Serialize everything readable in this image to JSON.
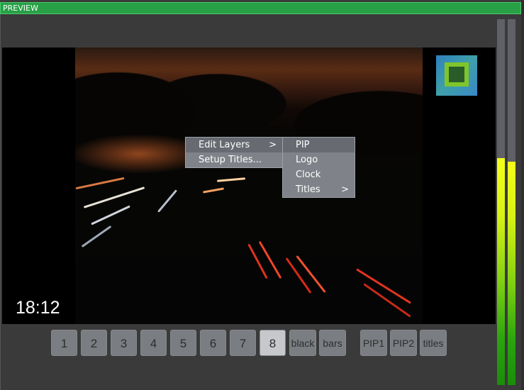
{
  "panel": {
    "title": "PREVIEW"
  },
  "overlay": {
    "clock_text": "18:12"
  },
  "context_menu": {
    "items": [
      {
        "label": "Edit Layers",
        "arrow": ">"
      },
      {
        "label": "Setup Titles..."
      }
    ]
  },
  "submenu": {
    "items": [
      {
        "label": "PIP"
      },
      {
        "label": "Logo"
      },
      {
        "label": "Clock"
      },
      {
        "label": "Titles",
        "arrow": ">"
      }
    ]
  },
  "buttons": [
    {
      "label": "1"
    },
    {
      "label": "2"
    },
    {
      "label": "3"
    },
    {
      "label": "4"
    },
    {
      "label": "5"
    },
    {
      "label": "6"
    },
    {
      "label": "7"
    },
    {
      "label": "8",
      "selected": true
    },
    {
      "label": "black"
    },
    {
      "label": "bars"
    },
    {
      "label": "PIP1"
    },
    {
      "label": "PIP2"
    },
    {
      "label": "titles"
    }
  ],
  "meters": {
    "left_level": 0.62,
    "right_level": 0.61
  },
  "colors": {
    "titlebar": "#27a046",
    "meter_top": "#f4ff1a",
    "meter_bottom": "#1a8d0a"
  }
}
